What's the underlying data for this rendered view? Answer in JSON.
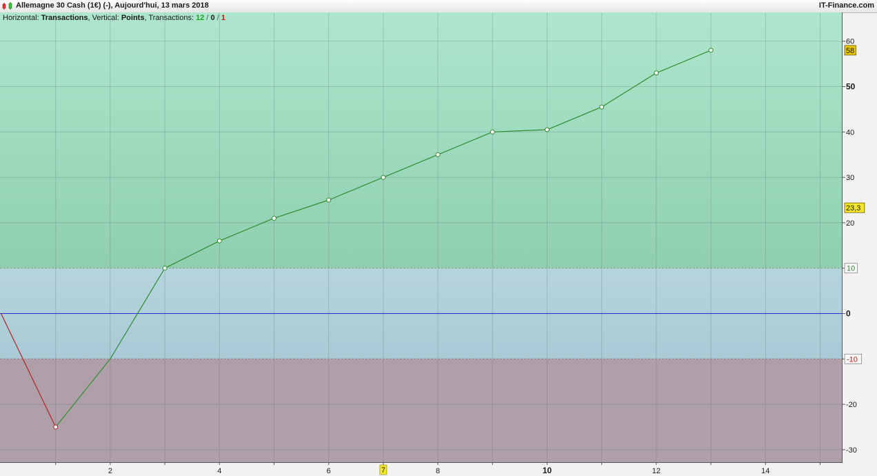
{
  "header": {
    "title": "Allemagne 30 Cash (1€) (-), Aujourd'hui, 13 mars 2018",
    "brand": "IT-Finance.com"
  },
  "info": {
    "horizontal_label": "Horizontal:",
    "horizontal_value": "Transactions",
    "vertical_label": "Vertical:",
    "vertical_value": "Points",
    "transactions_label": "Transactions:",
    "won": "12",
    "sep1": "/",
    "neutral": "0",
    "sep2": "/",
    "lost": "1"
  },
  "colors": {
    "zone_upper": "#8fcfb0",
    "zone_middle": "#a9cad6",
    "zone_lower": "#ae9fa9",
    "line_up": "#2e8b2e",
    "line_down": "#b32222",
    "zero_line": "#1d2fd1",
    "highlight": "#f5e628"
  },
  "chart_data": {
    "type": "line",
    "xlim": [
      0,
      15.5
    ],
    "ylim": [
      -33,
      66
    ],
    "x_ticks": [
      2,
      4,
      6,
      8,
      10,
      12,
      14
    ],
    "x_ticks_bold": [
      10
    ],
    "x_minor_ticks": [
      1,
      3,
      5,
      7,
      9,
      11,
      13,
      15
    ],
    "x_highlight": {
      "value": 7,
      "label": "7"
    },
    "y_ticks": [
      {
        "value": 60,
        "label": "60"
      },
      {
        "value": 50,
        "label": "50",
        "bold": true
      },
      {
        "value": 40,
        "label": "40"
      },
      {
        "value": 30,
        "label": "30"
      },
      {
        "value": 20,
        "label": "20"
      },
      {
        "value": 0,
        "label": "0",
        "bold": true
      },
      {
        "value": -20,
        "label": "-20"
      },
      {
        "value": -30,
        "label": "-30"
      }
    ],
    "zones": {
      "upper_threshold": 10,
      "lower_threshold": -10
    },
    "threshold_labels": [
      {
        "value": 10,
        "label": "10",
        "color": "#2e8b2e"
      },
      {
        "value": -10,
        "label": "-10",
        "color": "#c81414"
      }
    ],
    "value_labels": [
      {
        "value": 58,
        "label": "58",
        "color": "#e8c50a"
      },
      {
        "value": 23.3,
        "label": "23,3",
        "color": "#f5e628"
      }
    ],
    "x": [
      0,
      1,
      2,
      3,
      4,
      5,
      6,
      7,
      8,
      9,
      10,
      11,
      12,
      13
    ],
    "y": [
      0,
      -25,
      -10,
      10,
      16,
      21,
      25,
      30,
      35,
      40,
      40.5,
      45.5,
      53,
      58
    ],
    "grid": true
  }
}
